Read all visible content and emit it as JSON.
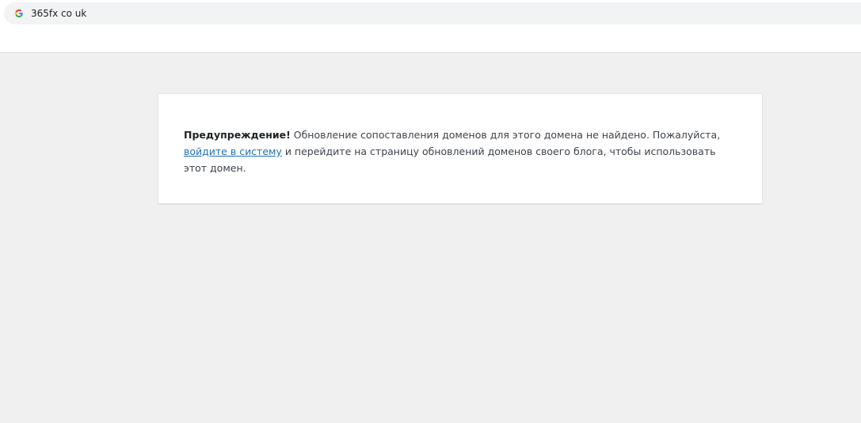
{
  "browser": {
    "url": "365fx co uk",
    "search_engine_icon": "google-g-icon"
  },
  "notice": {
    "warning_label": "Предупреждение!",
    "text_before_link": " Обновление сопоставления доменов для этого домена не найдено. Пожалуйста, ",
    "link_label": "войдите в систему",
    "text_after_link": " и перейдите на страницу обновлений доменов своего блога, чтобы использовать этот домен."
  },
  "colors": {
    "page_background": "#f0f0f1",
    "link": "#2271b1",
    "text": "#3c434a"
  }
}
